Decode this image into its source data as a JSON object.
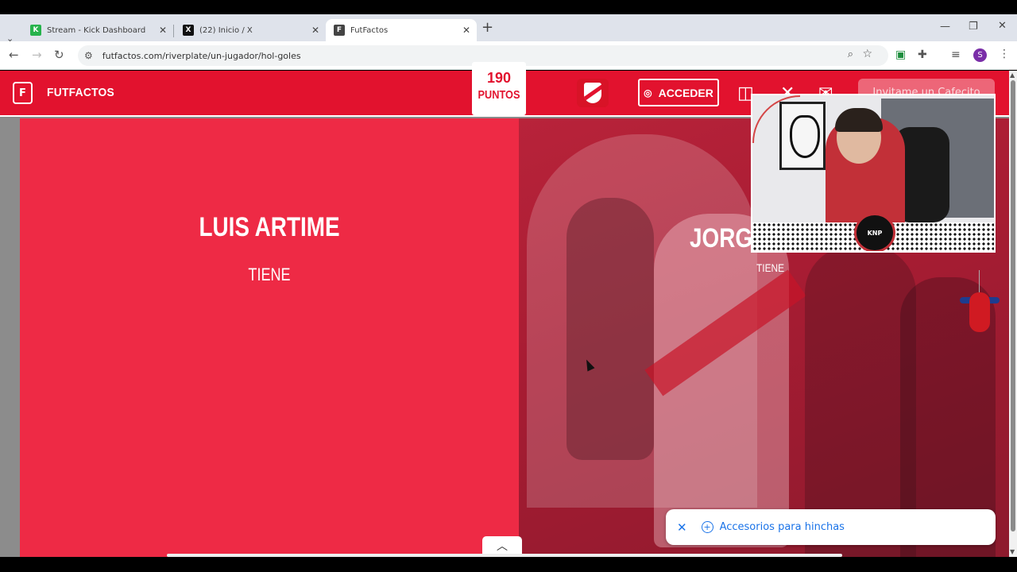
{
  "browser": {
    "tabs": [
      {
        "title": "Stream - Kick Dashboard",
        "favicon_color": "#27b34c",
        "favicon_letter": "K"
      },
      {
        "title": "(22) Inicio / X",
        "favicon_color": "#111111",
        "favicon_letter": "X"
      },
      {
        "title": "FutFactos",
        "favicon_color": "#444444",
        "favicon_letter": "F",
        "active": true
      }
    ],
    "new_tab": "+",
    "url": "futfactos.com/riverplate/un-jugador/hol-goles",
    "profile_initial": "S"
  },
  "site": {
    "brand": "FUTFACTOS",
    "logo_letter": "F",
    "login_label": "ACCEDER",
    "cafecito_label": "Invitame un Cafecito",
    "accent_color": "#e2122e"
  },
  "game": {
    "points_value": "190",
    "points_label": "PUNTOS",
    "left_player": {
      "name": "LUIS ARTIME",
      "verb": "TIENE"
    },
    "right_player": {
      "name": "JORGE",
      "verb": "TIENE"
    }
  },
  "webcam": {
    "badge": "KNP"
  },
  "toast": {
    "label": "Accesorios para hinchas"
  }
}
